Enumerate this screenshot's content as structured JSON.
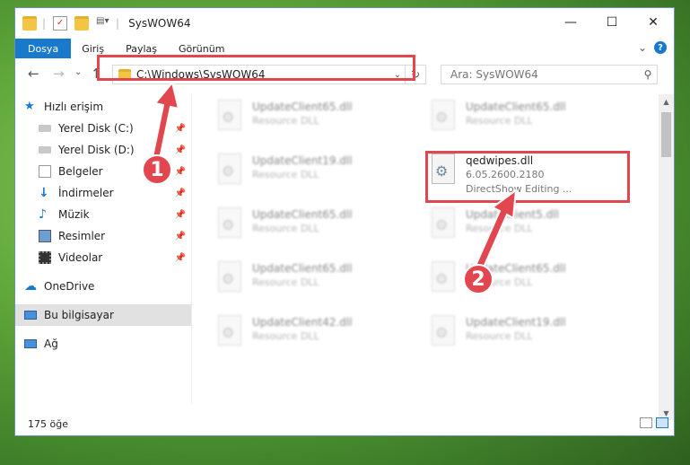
{
  "window": {
    "title": "SysWOW64",
    "caption": {
      "minimize": "—",
      "maximize": "☐",
      "close": "✕"
    }
  },
  "ribbon": {
    "tabs": [
      "Dosya",
      "Giriş",
      "Paylaş",
      "Görünüm"
    ],
    "expand": "⌄",
    "help": "?"
  },
  "address": {
    "path": "C:\\Windows\\SysWOW64",
    "back": "←",
    "forward": "→",
    "recent": "⌄",
    "up": "↑",
    "dropdown": "⌄",
    "refresh": "↻"
  },
  "search": {
    "placeholder": "Ara: SysWOW64",
    "icon": "search-icon"
  },
  "sidebar": {
    "items": [
      {
        "label": "Hızlı erişim",
        "icon": "star-icon",
        "pinned": false
      },
      {
        "label": "Yerel Disk (C:)",
        "icon": "drive-icon",
        "pinned": true
      },
      {
        "label": "Yerel Disk (D:)",
        "icon": "drive-icon",
        "pinned": true
      },
      {
        "label": "Belgeler",
        "icon": "documents-icon",
        "pinned": true
      },
      {
        "label": "İndirmeler",
        "icon": "download-icon",
        "pinned": true
      },
      {
        "label": "Müzik",
        "icon": "music-icon",
        "pinned": true
      },
      {
        "label": "Resimler",
        "icon": "pictures-icon",
        "pinned": true
      },
      {
        "label": "Videolar",
        "icon": "videos-icon",
        "pinned": true
      },
      {
        "label": "OneDrive",
        "icon": "onedrive-icon",
        "pinned": false
      },
      {
        "label": "Bu bilgisayar",
        "icon": "computer-icon",
        "pinned": false,
        "selected": true
      },
      {
        "label": "Ağ",
        "icon": "network-icon",
        "pinned": false
      }
    ],
    "pin_glyph": "📌"
  },
  "files": [
    {
      "name": "UpdateClient65.dll",
      "sub": "Resource DLL"
    },
    {
      "name": "UpdateClient65.dll",
      "sub": "Resource DLL"
    },
    {
      "name": "UpdateClient19.dll",
      "sub": "Resource DLL"
    },
    {
      "name": "qedwipes.dll",
      "version": "6.05.2600.2180",
      "desc": "DirectShow Editing ..."
    },
    {
      "name": "UpdateClient65.dll",
      "sub": "Resource DLL"
    },
    {
      "name": "UpdateClient5.dll",
      "sub": "Resource DLL"
    },
    {
      "name": "UpdateClient65.dll",
      "sub": "Resource DLL"
    },
    {
      "name": "UpdateClient65.dll",
      "sub": "Resource DLL"
    },
    {
      "name": "UpdateClient42.dll",
      "sub": "Resource DLL"
    },
    {
      "name": "UpdateClient19.dll",
      "sub": "Resource DLL"
    }
  ],
  "status": {
    "count": "175 öğe"
  },
  "annotations": {
    "step1": "1",
    "step2": "2",
    "color": "#e2474f"
  }
}
